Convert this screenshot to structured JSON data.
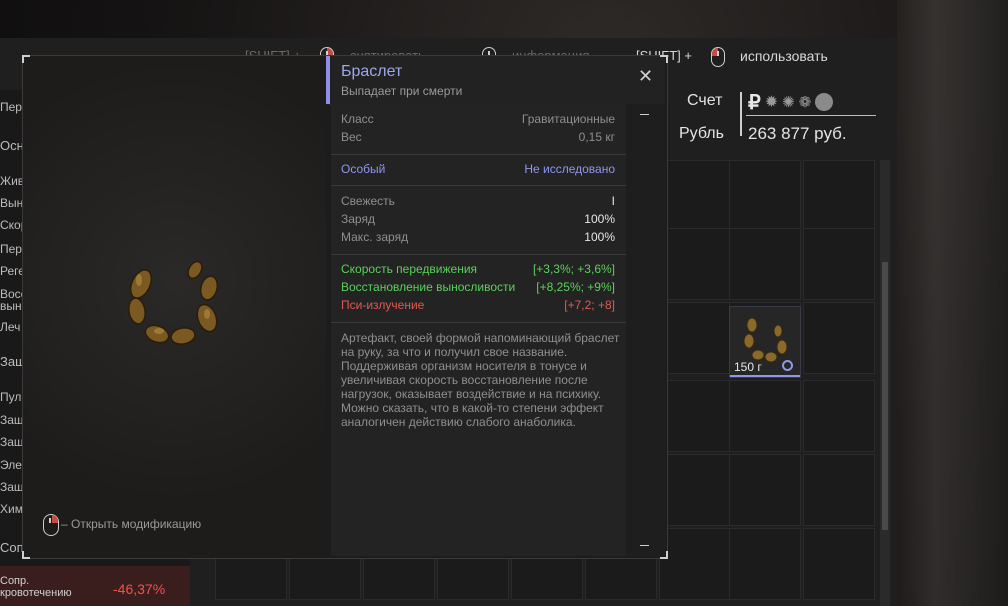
{
  "hints": {
    "unequip": "[SHIFT] +",
    "unequip_text": "снятировать",
    "info_text": "информация",
    "use_prefix": "[SHIFT] +",
    "use_text": "использовать"
  },
  "money": {
    "account_label": "Счет",
    "currency_label": "Рубль",
    "amount": "263 877 руб.",
    "currency_icons": [
      "ruble-icon",
      "gear-currency-icon",
      "splash-currency-icon",
      "cone-currency-icon",
      "coin-currency-icon"
    ]
  },
  "left_panel": {
    "items": [
      "Пер",
      "Осно",
      "Жив",
      "Вын",
      "Скор",
      "Пер",
      "Реге",
      "Восс",
      "вын",
      "Леч",
      "Заш",
      "Пул",
      "Защ",
      "Защ",
      "Эле",
      "Защ",
      "Хим",
      "Сопр"
    ],
    "bottom_label_1": "Сопр.",
    "bottom_label_2": "кровотечению",
    "bottom_value": "-46,37%"
  },
  "inventory_item": {
    "weight": "150 г"
  },
  "tooltip": {
    "title": "Браслет",
    "subtitle": "Выпадает при смерти",
    "props": [
      {
        "k": "Класс",
        "v": "Гравитационные"
      },
      {
        "k": "Вес",
        "v": "0,15 кг"
      }
    ],
    "special_label": "Особый",
    "special_value": "Не исследовано",
    "state": [
      {
        "k": "Свежесть",
        "v": "I"
      },
      {
        "k": "Заряд",
        "v": "100%"
      },
      {
        "k": "Макс. заряд",
        "v": "100%"
      }
    ],
    "effects": [
      {
        "k": "Скорость передвижения",
        "v": "[+3,3%; +3,6%]",
        "color": "#5bd15b"
      },
      {
        "k": "Восстановление выносливости",
        "v": "[+8,25%; +9%]",
        "color": "#5bd15b"
      },
      {
        "k": "Пси-излучение",
        "v": "[+7,2; +8]",
        "color": "#e05a52"
      }
    ],
    "description": "Артефакт, своей формой напоминающий браслет на руку, за что и получил свое название. Поддерживая организм носителя в тонусе и увеличивая скорость восстановление после нагрузок, оказывает воздействие и на психику. Можно сказать, что в какой-то степени эффект аналогичен действию слабого анаболика.",
    "modify_hint": "– Открыть модификацию"
  },
  "colors": {
    "accent": "#8e8ee8",
    "positive": "#5bd15b",
    "negative": "#e05a52",
    "title": "#9aa8f0"
  }
}
